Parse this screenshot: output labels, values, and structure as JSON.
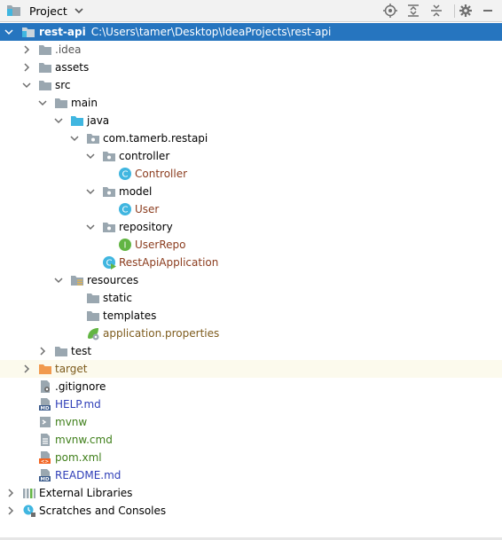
{
  "toolbar": {
    "title": "Project"
  },
  "tree": {
    "root": {
      "label": "rest-api",
      "path": "C:\\Users\\tamer\\Desktop\\IdeaProjects\\rest-api"
    },
    "idea": ".idea",
    "assets": "assets",
    "src": "src",
    "main": "main",
    "java": "java",
    "package": "com.tamerb.restapi",
    "controller_dir": "controller",
    "controller_class": "Controller",
    "model_dir": "model",
    "user_class": "User",
    "repository_dir": "repository",
    "userrepo": "UserRepo",
    "app_class": "RestApiApplication",
    "resources": "resources",
    "static": "static",
    "templates": "templates",
    "app_props": "application.properties",
    "test": "test",
    "target": "target",
    "gitignore": ".gitignore",
    "help_md": "HELP.md",
    "mvnw": "mvnw",
    "mvnw_cmd": "mvnw.cmd",
    "pom": "pom.xml",
    "readme": "README.md",
    "ext_libs": "External Libraries",
    "scratches": "Scratches and Consoles"
  },
  "colors": {
    "selection": "#2675bf",
    "folder": "#9aa7b0",
    "source_folder": "#40b6e0",
    "excluded_folder": "#f19a4e",
    "class_icon": "#40b6e0",
    "interface_icon": "#62b543"
  }
}
